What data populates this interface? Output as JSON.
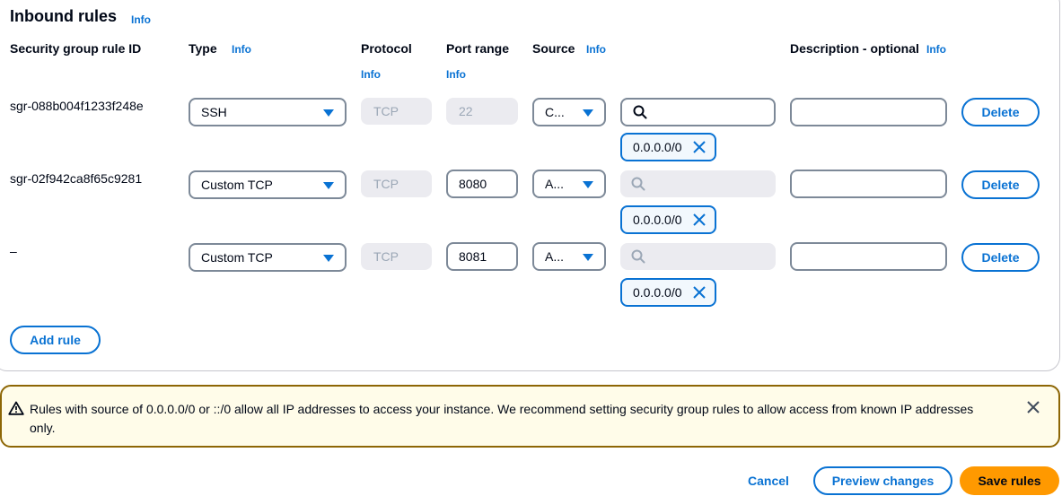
{
  "section": {
    "title": "Inbound rules",
    "info": "Info"
  },
  "columns": {
    "rule_id": "Security group rule ID",
    "type": "Type",
    "type_info": "Info",
    "protocol": "Protocol",
    "protocol_info": "Info",
    "port_range": "Port range",
    "port_info": "Info",
    "source": "Source",
    "source_info": "Info",
    "description": "Description - optional",
    "description_info": "Info"
  },
  "rules": [
    {
      "id": "sgr-088b004f1233f248e",
      "type": "SSH",
      "protocol": "TCP",
      "port": "22",
      "port_editable": false,
      "source_type": "C...",
      "search_active": true,
      "cidr": "0.0.0.0/0",
      "description": "",
      "delete_label": "Delete"
    },
    {
      "id": "sgr-02f942ca8f65c9281",
      "type": "Custom TCP",
      "protocol": "TCP",
      "port": "8080",
      "port_editable": true,
      "source_type": "A...",
      "search_active": false,
      "cidr": "0.0.0.0/0",
      "description": "",
      "delete_label": "Delete"
    },
    {
      "id": "–",
      "type": "Custom TCP",
      "protocol": "TCP",
      "port": "8081",
      "port_editable": true,
      "source_type": "A...",
      "search_active": false,
      "cidr": "0.0.0.0/0",
      "description": "",
      "delete_label": "Delete"
    }
  ],
  "add_rule_label": "Add rule",
  "warning": {
    "message": "Rules with source of 0.0.0.0/0 or ::/0 allow all IP addresses to access your instance. We recommend setting security group rules to allow access from known IP addresses only."
  },
  "footer": {
    "cancel": "Cancel",
    "preview": "Preview changes",
    "save": "Save rules"
  },
  "colors": {
    "link": "#0972d3",
    "primary": "#ff9900",
    "warning_border": "#8d6605",
    "warning_bg": "#fffce9"
  },
  "icons": [
    "info-link",
    "caret-down-icon",
    "search-icon",
    "dismiss-icon",
    "warning-icon",
    "close-icon"
  ]
}
